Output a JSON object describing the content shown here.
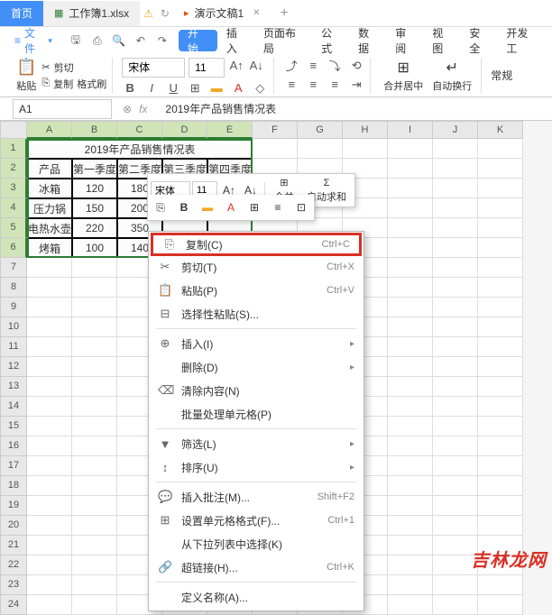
{
  "tabs": {
    "home": "首页",
    "file1": "工作簿1.xlsx",
    "file2": "演示文稿1"
  },
  "menubar": {
    "file": "文件",
    "start": "开始",
    "items": [
      "插入",
      "页面布局",
      "公式",
      "数据",
      "审阅",
      "视图",
      "安全",
      "开发工"
    ]
  },
  "toolbar": {
    "paste": "粘贴",
    "cut": "剪切",
    "copy": "复制",
    "fmtbrush": "格式刷",
    "font_name": "宋体",
    "font_size": "11",
    "merge_center": "合并居中",
    "autowrap": "自动换行",
    "general": "常规"
  },
  "namebox": {
    "ref": "A1",
    "formula": "2019年产品销售情况表"
  },
  "columns": [
    "A",
    "B",
    "C",
    "D",
    "E",
    "F",
    "G",
    "H",
    "I",
    "J",
    "K"
  ],
  "rows": [
    "1",
    "2",
    "3",
    "4",
    "5",
    "6",
    "7",
    "8",
    "9",
    "10",
    "11",
    "12",
    "13",
    "14",
    "15",
    "16",
    "17",
    "18",
    "19",
    "20",
    "21",
    "22",
    "23",
    "24"
  ],
  "table": {
    "title": "2019年产品销售情况表",
    "headers": [
      "产品",
      "第一季度",
      "第二季度",
      "第三季度",
      "第四季度"
    ],
    "rows": [
      [
        "冰箱",
        "120",
        "180",
        "",
        ""
      ],
      [
        "压力锅",
        "150",
        "200",
        "",
        ""
      ],
      [
        "电热水壶",
        "220",
        "350",
        "",
        ""
      ],
      [
        "烤箱",
        "100",
        "140",
        "",
        ""
      ]
    ]
  },
  "mini_toolbar": {
    "font_name": "宋体",
    "font_size": "11",
    "merge": "合并",
    "autosum": "自动求和"
  },
  "context_menu": {
    "copy": {
      "label": "复制(C)",
      "shortcut": "Ctrl+C"
    },
    "cut": {
      "label": "剪切(T)",
      "shortcut": "Ctrl+X"
    },
    "paste": {
      "label": "粘贴(P)",
      "shortcut": "Ctrl+V"
    },
    "paste_special": {
      "label": "选择性粘贴(S)..."
    },
    "insert": {
      "label": "插入(I)"
    },
    "delete": {
      "label": "删除(D)"
    },
    "clear": {
      "label": "清除内容(N)"
    },
    "batch": {
      "label": "批量处理单元格(P)"
    },
    "filter": {
      "label": "筛选(L)"
    },
    "sort": {
      "label": "排序(U)"
    },
    "insert_comment": {
      "label": "插入批注(M)...",
      "shortcut": "Shift+F2"
    },
    "format_cells": {
      "label": "设置单元格格式(F)...",
      "shortcut": "Ctrl+1"
    },
    "pick_from_list": {
      "label": "从下拉列表中选择(K)"
    },
    "hyperlink": {
      "label": "超链接(H)...",
      "shortcut": "Ctrl+K"
    },
    "define_name": {
      "label": "定义名称(A)..."
    }
  },
  "watermark": "吉林龙网"
}
